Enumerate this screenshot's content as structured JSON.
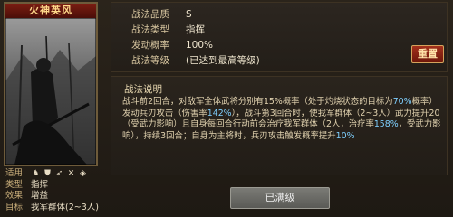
{
  "card": {
    "title": "火神英风"
  },
  "left_info": {
    "rows": [
      {
        "key": "适用",
        "icons": [
          "horse-icon",
          "shield-icon",
          "bow-icon",
          "spear-icon",
          "siege-icon"
        ]
      },
      {
        "key": "类型",
        "value": "指挥"
      },
      {
        "key": "效果",
        "value": "增益"
      },
      {
        "key": "目标",
        "value": "我军群体(2~3人)"
      }
    ]
  },
  "details": {
    "quality_key": "战法品质",
    "quality_value": "S",
    "type_key": "战法类型",
    "type_value": "指挥",
    "rate_key": "发动概率",
    "rate_value": "100%",
    "level_key": "战法等级",
    "level_value": "(已达到最高等级)"
  },
  "buttons": {
    "reset": "重置",
    "maxed": "已满级"
  },
  "description": {
    "title": "战法说明",
    "seg1": "战斗前2回合，对敌军全体武将分别有15%概率（处于灼烧状态的目标为",
    "hl1": "70%",
    "seg2": "概率）发动兵刃攻击（伤害率",
    "hl2": "142%",
    "seg3": "），战斗第3回合时，使我军群体（2~3人）武力提升20（受武力影响）且自身每回合行动前会治疗我军群体（2人，治疗率",
    "hl3": "158%",
    "seg4": "，受武力影响），持续3回合；自身为主将时，兵刃攻击触发概率提升",
    "hl4": "10%"
  }
}
